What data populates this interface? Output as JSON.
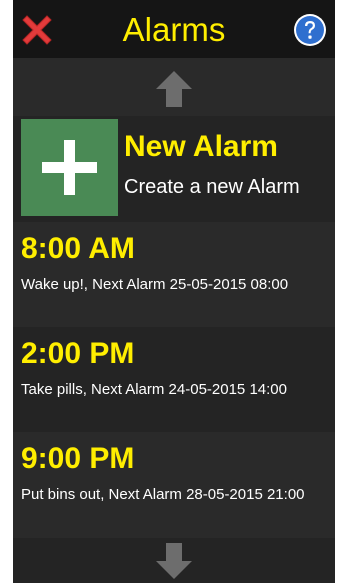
{
  "header": {
    "title": "Alarms",
    "close_icon": "close-icon",
    "help_icon": "help-icon"
  },
  "navigation": {
    "up_icon": "arrow-up-icon",
    "down_icon": "arrow-down-icon"
  },
  "new_alarm": {
    "title": "New Alarm",
    "subtitle": "Create a new Alarm",
    "icon": "plus-icon"
  },
  "alarms": [
    {
      "time": "8:00 AM",
      "description": "Wake up!, Next Alarm 25-05-2015 08:00"
    },
    {
      "time": "2:00 PM",
      "description": "Take pills, Next Alarm 24-05-2015 14:00"
    },
    {
      "time": "9:00 PM",
      "description": "Put bins out, Next Alarm 28-05-2015 21:00"
    }
  ],
  "colors": {
    "accent": "#ffee00",
    "background": "#2a2a2a",
    "header": "#151515",
    "row_alt": "#242424",
    "new_alarm_tile": "#4a8a55",
    "close": "#e23b3b",
    "help": "#2f6fcf"
  }
}
